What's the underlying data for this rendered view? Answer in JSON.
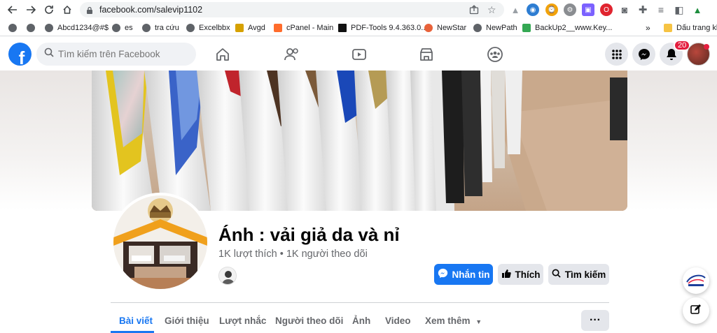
{
  "browser": {
    "url": "facebook.com/salevip1102",
    "bookmarks": [
      {
        "label": ""
      },
      {
        "label": ""
      },
      {
        "label": "Abcd1234@#$"
      },
      {
        "label": "es"
      },
      {
        "label": "tra cứu"
      },
      {
        "label": "Excelbbx"
      },
      {
        "label": "Avgd"
      },
      {
        "label": "cPanel - Main"
      },
      {
        "label": "PDF-Tools 9.4.363.0..."
      },
      {
        "label": "NewStar"
      },
      {
        "label": "NewPath"
      },
      {
        "label": "BackUp2__www.Key..."
      }
    ],
    "overflow": "»",
    "other_folder": "Dấu trang kh"
  },
  "fb": {
    "logo": "f",
    "search_placeholder": "Tìm kiếm trên Facebook",
    "notification_count": "20"
  },
  "profile": {
    "name": "Ánh : vải giả da và nỉ",
    "stats": "1K lượt thích • 1K người theo dõi",
    "buttons": {
      "message": "Nhắn tin",
      "like": "Thích",
      "search": "Tìm kiếm"
    },
    "tabs": [
      "Bài viết",
      "Giới thiệu",
      "Lượt nhắc",
      "Người theo dõi",
      "Ảnh",
      "Video",
      "Xem thêm"
    ],
    "more": "···"
  },
  "colors": {
    "fb_blue": "#1877f2",
    "badge_red": "#e41e3f"
  }
}
